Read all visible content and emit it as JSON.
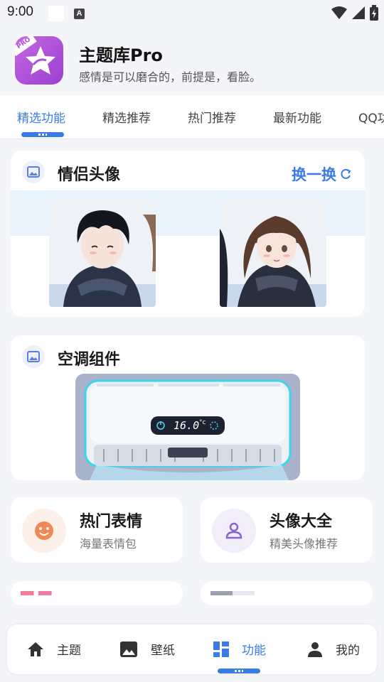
{
  "status_bar": {
    "time": "9:00",
    "a_icon": "A",
    "icons": [
      "wifi-icon",
      "signal-icon",
      "battery-icon"
    ]
  },
  "header": {
    "app_name": "主题库Pro",
    "subtitle": "感情是可以磨合的，前提是，看脸。",
    "icon_badge": "PRO",
    "accent": "#b050db"
  },
  "tabs": [
    {
      "label": "精选功能",
      "active": true
    },
    {
      "label": "精选推荐",
      "active": false
    },
    {
      "label": "热门推荐",
      "active": false
    },
    {
      "label": "最新功能",
      "active": false
    },
    {
      "label": "QQ功",
      "active": false
    }
  ],
  "couple_card": {
    "title": "情侣头像",
    "swap_label": "换一换",
    "icon": "image-icon"
  },
  "ac_card": {
    "title": "空调组件",
    "icon": "image-icon",
    "display_value": "16.0",
    "display_unit": "°c"
  },
  "features": [
    {
      "title": "热门表情",
      "subtitle": "海量表情包",
      "icon": "smile-icon",
      "icon_bg": "#fdf0e8",
      "icon_color": "#f08a55"
    },
    {
      "title": "头像大全",
      "subtitle": "精美头像推荐",
      "icon": "person-icon",
      "icon_bg": "#f1eef9",
      "icon_color": "#8a63c9"
    }
  ],
  "bottom_nav": [
    {
      "label": "主题",
      "icon": "home-icon",
      "active": false
    },
    {
      "label": "壁纸",
      "icon": "image-icon",
      "active": false
    },
    {
      "label": "功能",
      "icon": "dashboard-icon",
      "active": true
    },
    {
      "label": "我的",
      "icon": "person-icon",
      "active": false
    }
  ],
  "colors": {
    "accent": "#3b7be8",
    "background": "#f4f5f9"
  }
}
